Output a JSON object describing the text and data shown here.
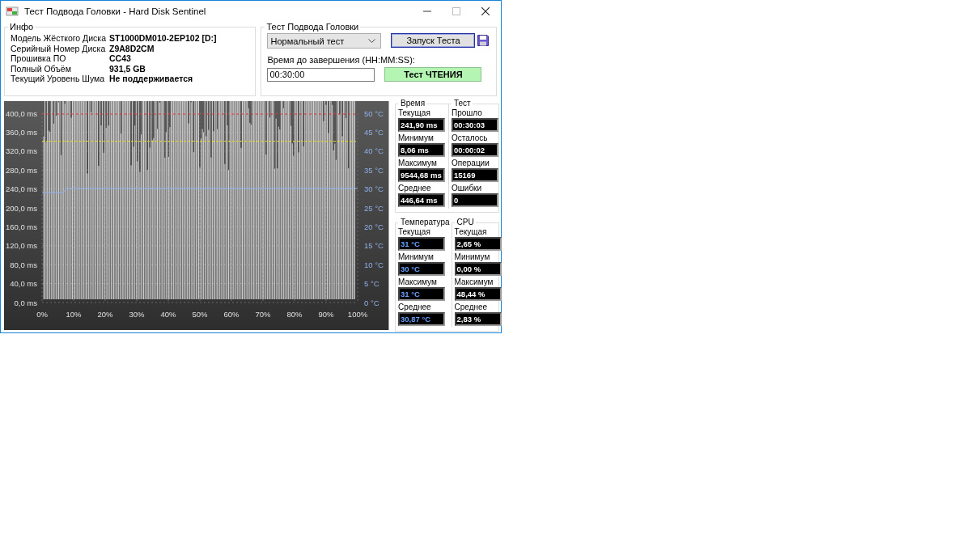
{
  "window": {
    "title": "Тест Подвода Головки - Hard Disk Sentinel"
  },
  "info": {
    "title": "Инфо",
    "rows": [
      {
        "label": "Модель Жёсткого Диска",
        "value": "ST1000DM010-2EP102 [D:]"
      },
      {
        "label": "Серийный Номер Диска",
        "value": "Z9A8D2CM"
      },
      {
        "label": "Прошивка ПО",
        "value": "CC43"
      },
      {
        "label": "Полный Объём",
        "value": "931,5 GB"
      },
      {
        "label": "Текущий Уровень Шума",
        "value": "Не поддерживается"
      }
    ]
  },
  "test": {
    "title": "Тест Подвода Головки",
    "mode": "Нормальный тест",
    "start_button": "Запуск Теста",
    "time_label": "Время до завершения (HH:MM:SS):",
    "time_value": "00:30:00",
    "status": "Тест ЧТЕНИЯ"
  },
  "chart": {
    "y_left_ticks": [
      "400,0 ms",
      "360,0 ms",
      "320,0 ms",
      "280,0 ms",
      "240,0 ms",
      "200,0 ms",
      "160,0 ms",
      "120,0 ms",
      "80,0 ms",
      "40,0 ms",
      "0,0 ms"
    ],
    "y_right_ticks": [
      "50 °C",
      "45 °C",
      "40 °C",
      "35 °C",
      "30 °C",
      "25 °C",
      "20 °C",
      "15 °C",
      "10 °C",
      "5 °C",
      "0 °C"
    ],
    "x_ticks": [
      "0%",
      "10%",
      "20%",
      "30%",
      "40%",
      "50%",
      "60%",
      "70%",
      "80%",
      "90%",
      "100%"
    ]
  },
  "stat_groups": [
    {
      "columns": [
        {
          "title": "Время",
          "kind": "time",
          "items": [
            {
              "label": "Текущая",
              "value": "241,90 ms"
            },
            {
              "label": "Минимум",
              "value": "8,06 ms"
            },
            {
              "label": "Максимум",
              "value": "9544,68 ms"
            },
            {
              "label": "Среднее",
              "value": "446,64 ms"
            }
          ]
        },
        {
          "title": "Тест",
          "kind": "test",
          "items": [
            {
              "label": "Прошло",
              "value": "00:30:03"
            },
            {
              "label": "Осталось",
              "value": "00:00:02"
            },
            {
              "label": "Операции",
              "value": "15169"
            },
            {
              "label": "Ошибки",
              "value": "0"
            }
          ]
        }
      ]
    },
    {
      "columns": [
        {
          "title": "Температура",
          "kind": "temperature",
          "items": [
            {
              "label": "Текущая",
              "value": "31 °C"
            },
            {
              "label": "Минимум",
              "value": "30 °C"
            },
            {
              "label": "Максимум",
              "value": "31 °C"
            },
            {
              "label": "Среднее",
              "value": "30,87 °C"
            }
          ]
        },
        {
          "title": "CPU",
          "kind": "cpu",
          "items": [
            {
              "label": "Текущая",
              "value": "2,65 %"
            },
            {
              "label": "Минимум",
              "value": "0,00 %"
            },
            {
              "label": "Максимум",
              "value": "48,44 %"
            },
            {
              "label": "Среднее",
              "value": "2,83 %"
            }
          ]
        }
      ]
    }
  ]
}
